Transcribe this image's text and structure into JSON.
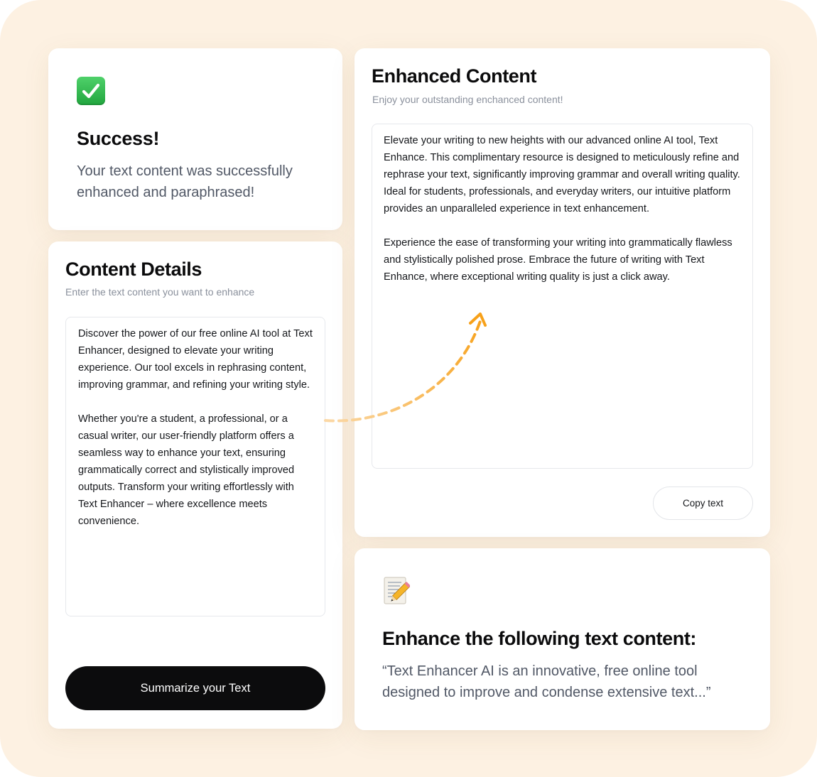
{
  "success": {
    "icon": "check-mark-icon",
    "title": "Success!",
    "message": "Your text content was successfully enhanced and paraphrased!"
  },
  "details": {
    "title": "Content Details",
    "subtitle": "Enter the text content you want to enhance",
    "input_text": "Discover the power of our free online AI tool at Text Enhancer, designed to elevate your writing experience. Our tool excels in rephrasing content, improving grammar, and refining your writing style.\n\nWhether you're a student, a professional, or a casual writer, our user-friendly platform offers a seamless way to enhance your text, ensuring grammatically correct and stylistically improved outputs. Transform your writing effortlessly with Text Enhancer – where excellence meets convenience.",
    "button_label": "Summarize your Text"
  },
  "enhanced": {
    "title": "Enhanced Content",
    "subtitle": "Enjoy your outstanding enchanced content!",
    "output_text": "Elevate your writing to new heights with our advanced online AI tool, Text Enhance. This complimentary resource is designed to meticulously refine and rephrase your text, significantly improving grammar and overall writing quality. Ideal for students, professionals, and everyday writers, our intuitive platform provides an unparalleled experience in text enhancement.\n\nExperience the ease of transforming your writing into grammatically flawless and stylistically polished prose. Embrace the future of writing with Text Enhance, where exceptional writing quality is just a click away.",
    "copy_label": "Copy text"
  },
  "prompt": {
    "icon": "memo-pencil-icon",
    "title": "Enhance the following text content:",
    "quote": "“Text Enhancer AI is an innovative, free online tool designed to improve and condense extensive text...”"
  },
  "colors": {
    "background": "#fdf1e2",
    "arrow": "#f7a11a",
    "button": "#0c0c0d"
  }
}
